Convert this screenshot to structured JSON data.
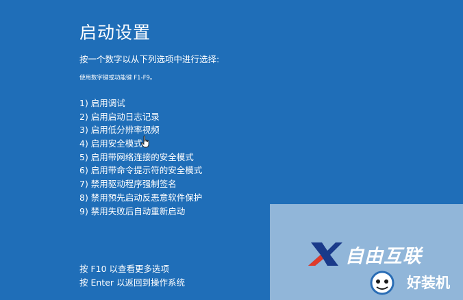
{
  "screen": {
    "title": "启动设置",
    "prompt": "按一个数字以从下列选项中进行选择:",
    "hint": "使用数字键或功能键 F1-F9。",
    "options": [
      {
        "label": "1) 启用调试"
      },
      {
        "label": "2) 启用启动日志记录"
      },
      {
        "label": "3) 启用低分辨率视频"
      },
      {
        "label": "4) 启用安全模式"
      },
      {
        "label": "5) 启用带网络连接的安全模式"
      },
      {
        "label": "6) 启用带命令提示符的安全模式"
      },
      {
        "label": "7) 禁用驱动程序强制签名"
      },
      {
        "label": "8) 禁用预先启动反恶意软件保护"
      },
      {
        "label": "9) 禁用失败后自动重新启动"
      }
    ],
    "footer": {
      "more_options": "按 F10 以查看更多选项",
      "return_os": "按 Enter 以返回到操作系统"
    }
  },
  "watermark": {
    "brand1": "自由互联",
    "brand2": "好装机",
    "brand1_icon": "x-logo-icon",
    "brand2_icon": "mascot-logo-icon"
  },
  "colors": {
    "background": "#1f6eb8",
    "text": "#ffffff"
  }
}
